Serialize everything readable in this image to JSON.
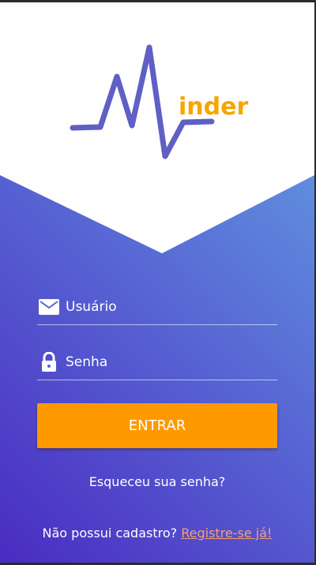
{
  "logo": {
    "text": "inder",
    "line_color": "#5f5fc4",
    "text_color": "#f7a500"
  },
  "login": {
    "username_placeholder": "Usuário",
    "password_placeholder": "Senha",
    "submit_label": "ENTRAR",
    "forgot_label": "Esqueceu sua senha?",
    "signup_prompt": "Não possui cadastro?",
    "signup_link": "Registre-se já!"
  },
  "colors": {
    "accent": "#ff9900",
    "link": "#f7a070"
  }
}
